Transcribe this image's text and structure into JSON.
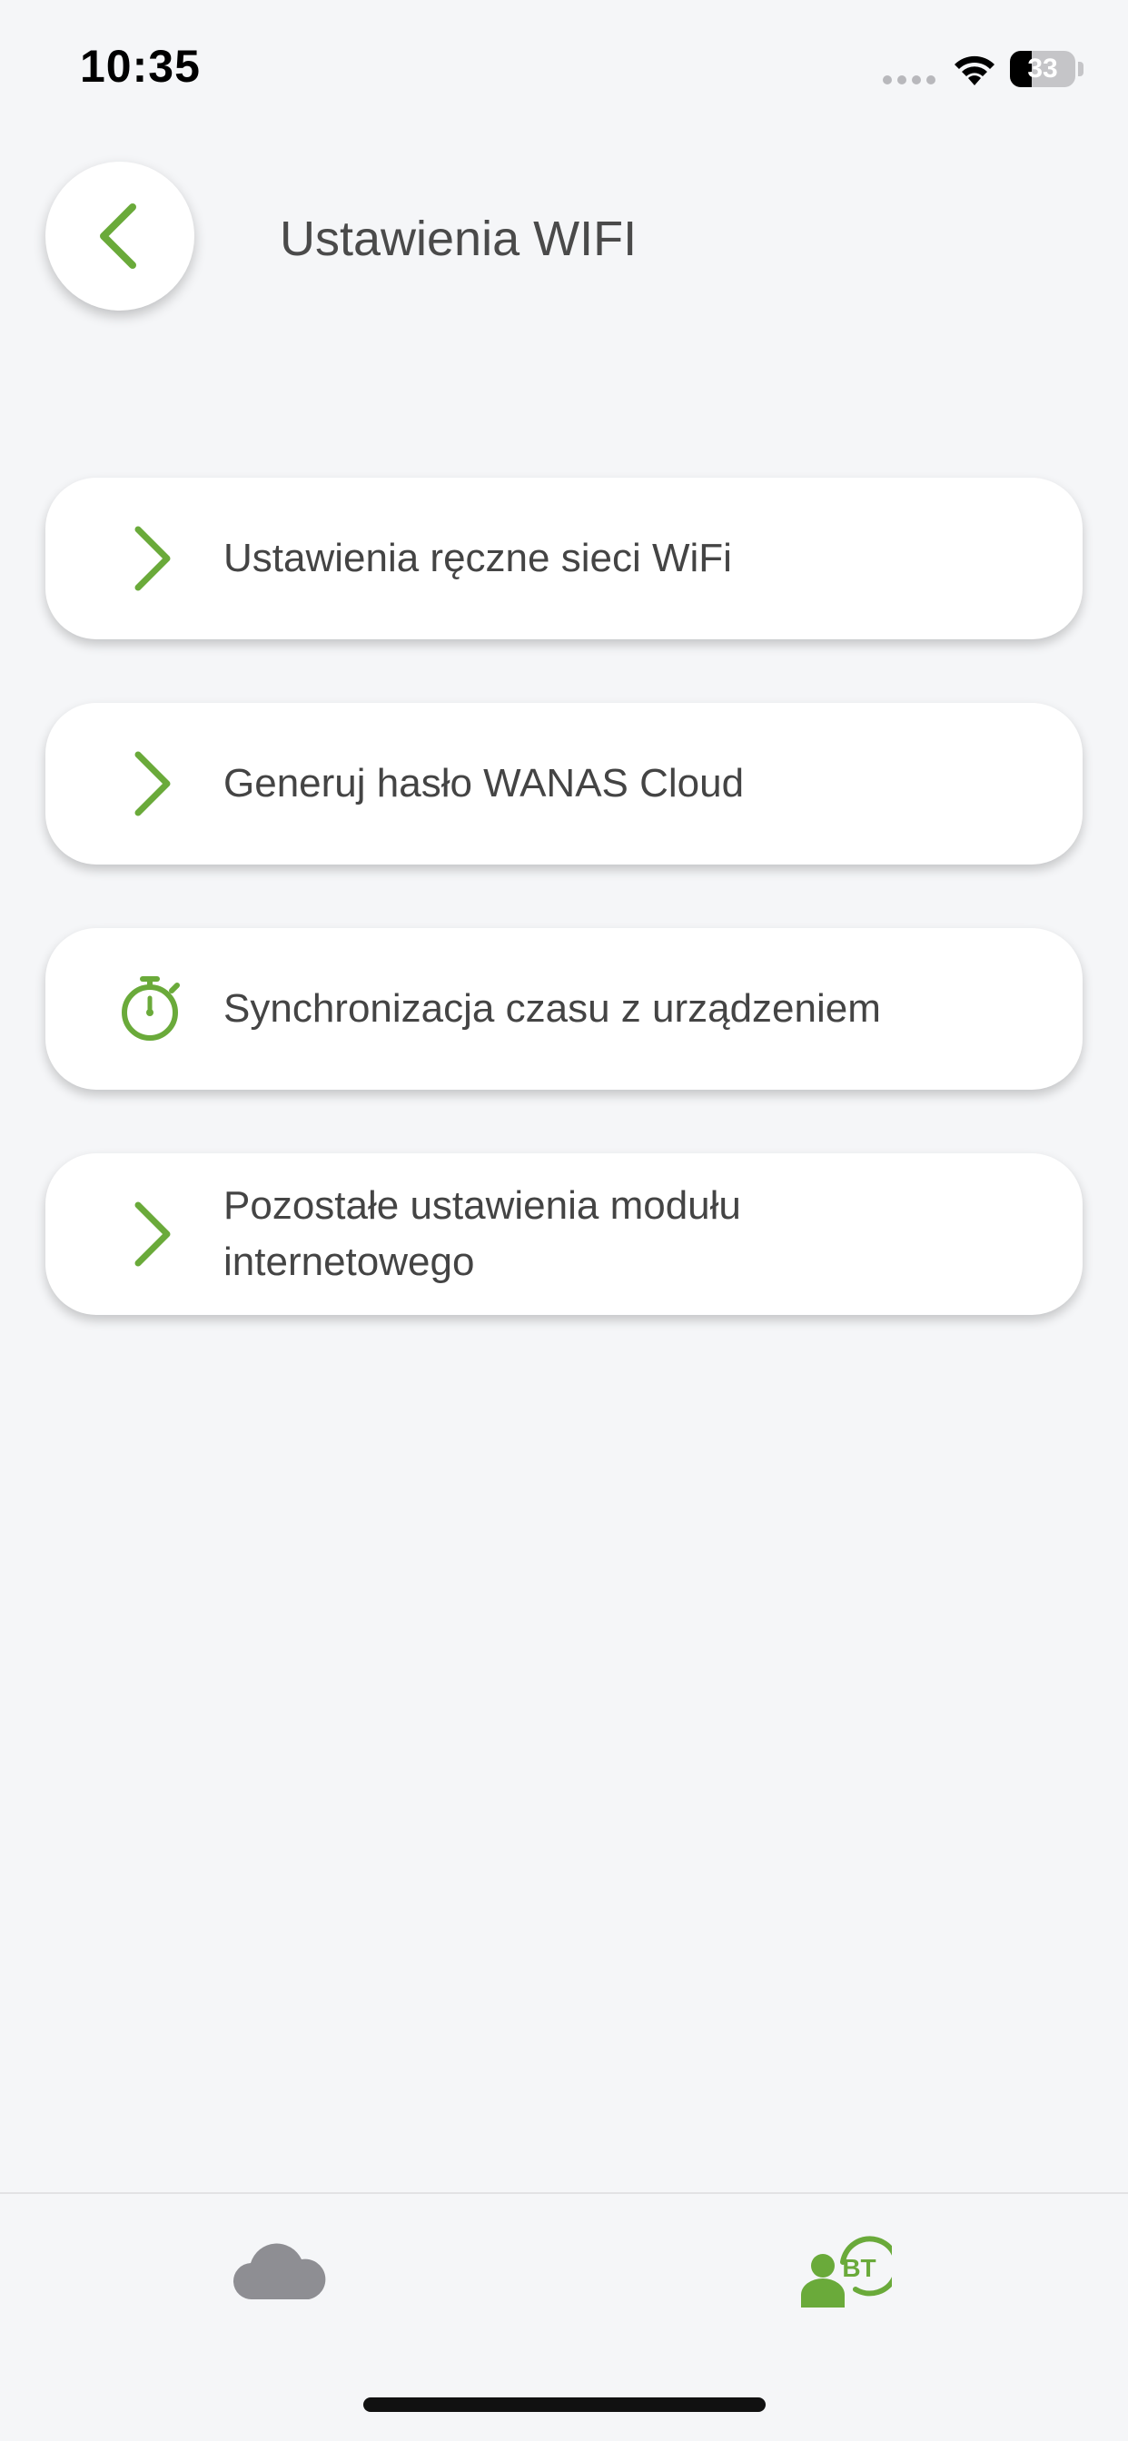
{
  "status_bar": {
    "time": "10:35",
    "battery_level": "33",
    "battery_fraction": 0.33,
    "signal_icon": "signal-dots-icon",
    "wifi_icon": "wifi-icon",
    "battery_icon": "battery-icon"
  },
  "header": {
    "title": "Ustawienia WIFI",
    "back_icon": "chevron-left-icon"
  },
  "menu": {
    "items": [
      {
        "label": "Ustawienia ręczne sieci WiFi",
        "icon": "chevron-right-icon"
      },
      {
        "label": "Generuj hasło WANAS Cloud",
        "icon": "chevron-right-icon"
      },
      {
        "label": "Synchronizacja czasu z urządzeniem",
        "icon": "stopwatch-icon"
      },
      {
        "label": "Pozostałe ustawienia modułu internetowego",
        "icon": "chevron-right-icon"
      }
    ]
  },
  "tab_bar": {
    "tabs": [
      {
        "icon": "cloud-icon",
        "active": false
      },
      {
        "icon": "user-bluetooth-icon",
        "badge": "BT",
        "active": true
      }
    ]
  },
  "colors": {
    "accent": "#6aaa3a",
    "inactive_icon": "#8e8e93",
    "background": "#f5f6f8",
    "card": "#ffffff",
    "text": "#444444"
  }
}
